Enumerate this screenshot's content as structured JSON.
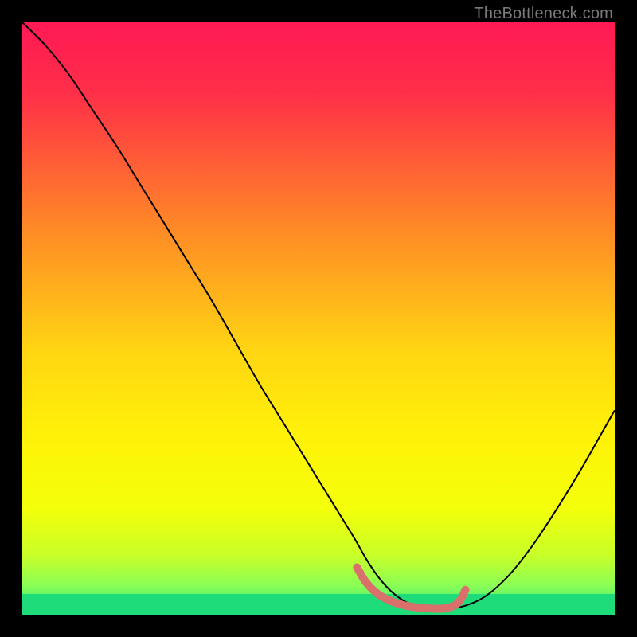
{
  "attribution": "TheBottleneck.com",
  "chart_data": {
    "type": "line",
    "title": "",
    "xlabel": "",
    "ylabel": "",
    "xlim": [
      0,
      100
    ],
    "ylim": [
      0,
      100
    ],
    "background_gradient": {
      "stops": [
        {
          "offset": 0,
          "color": "#ff1955"
        },
        {
          "offset": 12,
          "color": "#ff2f48"
        },
        {
          "offset": 35,
          "color": "#ff8a26"
        },
        {
          "offset": 55,
          "color": "#ffd413"
        },
        {
          "offset": 70,
          "color": "#fff208"
        },
        {
          "offset": 82,
          "color": "#f4ff0a"
        },
        {
          "offset": 90,
          "color": "#c8ff28"
        },
        {
          "offset": 95,
          "color": "#8cff55"
        },
        {
          "offset": 100,
          "color": "#26e67e"
        }
      ]
    },
    "series": [
      {
        "name": "bottleneck-curve",
        "color": "#000000",
        "width": 2,
        "x": [
          0,
          4,
          8,
          12,
          16,
          20,
          24,
          28,
          32,
          36,
          40,
          44,
          48,
          52,
          56,
          58,
          60,
          62,
          64,
          66,
          68,
          70,
          74,
          78,
          82,
          86,
          90,
          94,
          98,
          100
        ],
        "y": [
          100,
          96,
          91,
          85,
          79,
          72.5,
          66,
          59.5,
          53,
          46,
          39,
          32.5,
          26,
          19.5,
          13,
          9.5,
          6.5,
          4.2,
          2.6,
          1.6,
          1.1,
          1.0,
          1.3,
          3.0,
          6.5,
          11.5,
          17.5,
          24,
          31,
          34.5
        ]
      },
      {
        "name": "optimal-zone",
        "color": "#d9706c",
        "width": 10,
        "linecap": "round",
        "x": [
          56.5,
          58,
          60,
          62,
          64,
          66,
          68,
          70,
          71.5,
          73,
          74,
          74.8
        ],
        "y": [
          8.0,
          5.5,
          3.5,
          2.4,
          1.7,
          1.3,
          1.1,
          1.0,
          1.1,
          1.6,
          2.6,
          4.2
        ]
      }
    ],
    "green_band": {
      "y_from": 0,
      "y_to": 3.5
    }
  }
}
